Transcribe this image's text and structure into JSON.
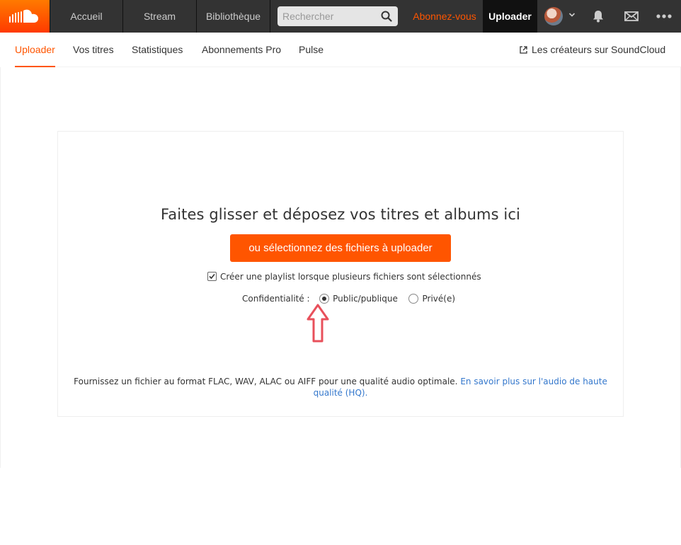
{
  "topnav": {
    "logo_icon": "soundcloud-cloud-icon",
    "tabs": [
      "Accueil",
      "Stream",
      "Bibliothèque"
    ],
    "search_placeholder": "Rechercher",
    "subscribe_label": "Abonnez-vous",
    "upload_label": "Uploader",
    "icons": [
      "bell-icon",
      "mail-icon",
      "more-icon"
    ]
  },
  "subnav": {
    "tabs": [
      "Uploader",
      "Vos titres",
      "Statistiques",
      "Abonnements Pro",
      "Pulse"
    ],
    "active_tab": "Uploader",
    "creators_link": "Les créateurs sur SoundCloud"
  },
  "upload": {
    "title": "Faites glisser et déposez vos titres et albums ici",
    "choose_button": "ou sélectionnez des fichiers à uploader",
    "playlist_checkbox_label": "Créer une playlist lorsque plusieurs fichiers sont sélectionnés",
    "playlist_checked": true,
    "privacy_label": "Confidentialité :",
    "privacy_options": [
      "Public/publique",
      "Privé(e)"
    ],
    "privacy_selected": "Public/publique",
    "quality_text": "Fournissez un fichier au format FLAC, WAV, ALAC ou AIFF pour une qualité audio optimale.",
    "quality_link": "En savoir plus sur l'audio de haute qualité (HQ)."
  },
  "colors": {
    "accent": "#ff5500",
    "topbar": "#333333",
    "link": "#3377cc",
    "annotation_arrow": "#e8505b"
  }
}
